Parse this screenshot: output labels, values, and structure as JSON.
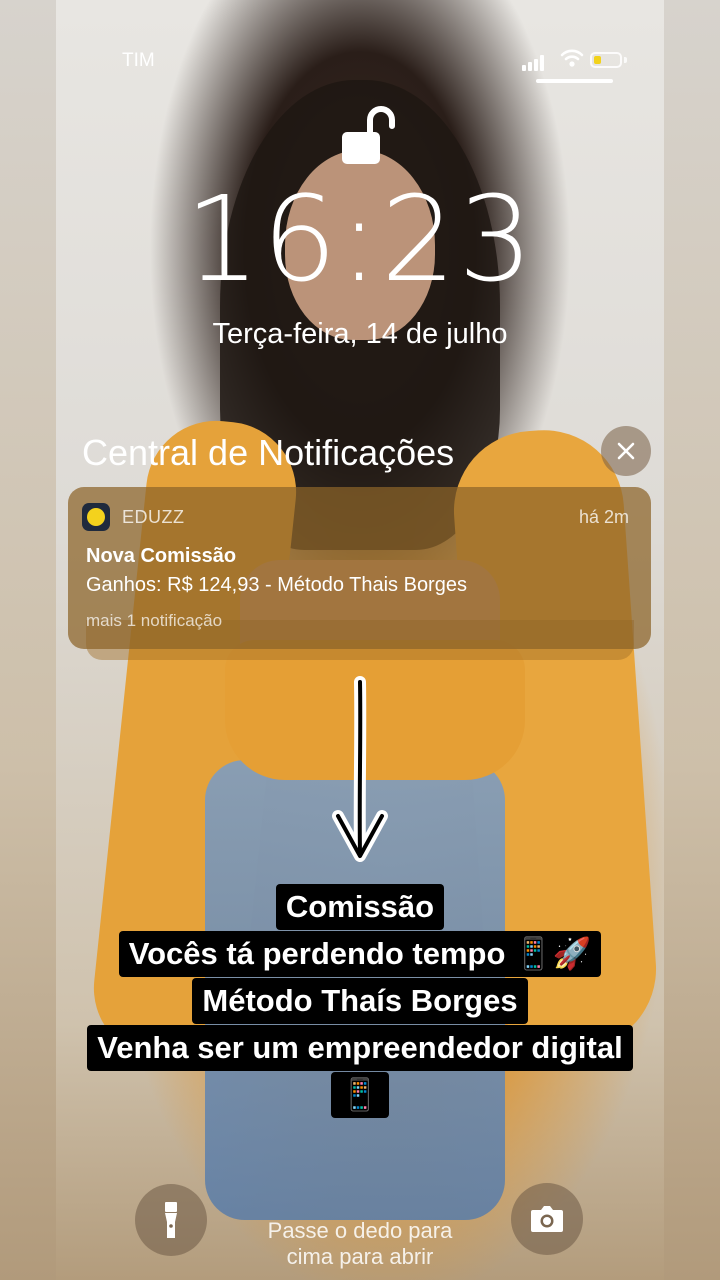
{
  "status_bar": {
    "carrier": "TIM",
    "battery_level": 0.3,
    "battery_color": "#f2d21b"
  },
  "lockscreen": {
    "time": "16:23",
    "date": "Terça-feira, 14 de julho",
    "notification_center_title": "Central de Notificações",
    "unlock_hint_line1": "Passe o dedo para",
    "unlock_hint_line2": "cima para abrir"
  },
  "notification": {
    "app_name": "EDUZZ",
    "time_ago": "há 2m",
    "title": "Nova Comissão",
    "body": "Ganhos: R$ 124,93 - Método Thais Borges",
    "more": "mais 1 notificação",
    "icon_color": "#f4d21d"
  },
  "caption": {
    "line1": "Comissão",
    "line2": "Vocês tá perdendo tempo 📱🚀",
    "line3": "Método Thaís Borges",
    "line4": "Venha ser um empreendedor digital",
    "line5": "📱"
  },
  "icons": [
    "lock-open-icon",
    "close-icon",
    "down-arrow-icon",
    "flashlight-icon",
    "camera-icon",
    "wifi-icon",
    "signal-icon",
    "battery-icon"
  ]
}
